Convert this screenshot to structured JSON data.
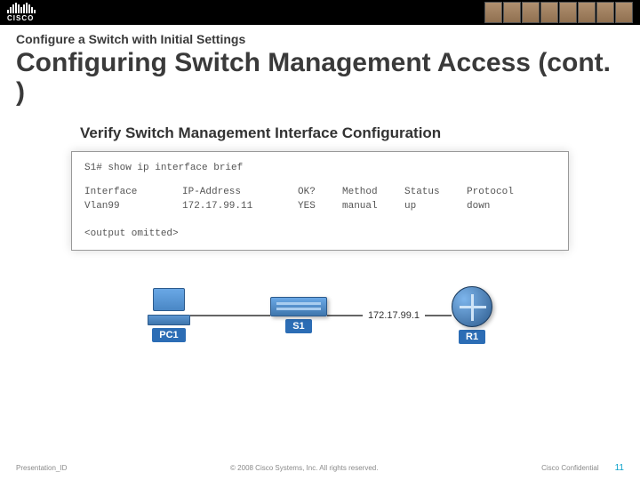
{
  "brand": {
    "name": "CISCO"
  },
  "kicker": "Configure a Switch with Initial Settings",
  "title": "Configuring Switch Management Access (cont. )",
  "panel": {
    "heading": "Verify Switch Management Interface Configuration",
    "command": "S1# show ip interface brief",
    "headers": {
      "c1": "Interface",
      "c2": "IP-Address",
      "c3": "OK?",
      "c4": "Method",
      "c5": "Status",
      "c6": "Protocol"
    },
    "row": {
      "c1": "Vlan99",
      "c2": "172.17.99.11",
      "c3": "YES",
      "c4": "manual",
      "c5": "up",
      "c6": "down"
    },
    "omitted": "<output omitted>"
  },
  "topology": {
    "pc_label": "PC1",
    "switch_label": "S1",
    "router_label": "R1",
    "ip_label": "172.17.99.1"
  },
  "footer": {
    "left": "Presentation_ID",
    "center": "© 2008 Cisco Systems, Inc. All rights reserved.",
    "right": "Cisco Confidential",
    "page": "11"
  }
}
